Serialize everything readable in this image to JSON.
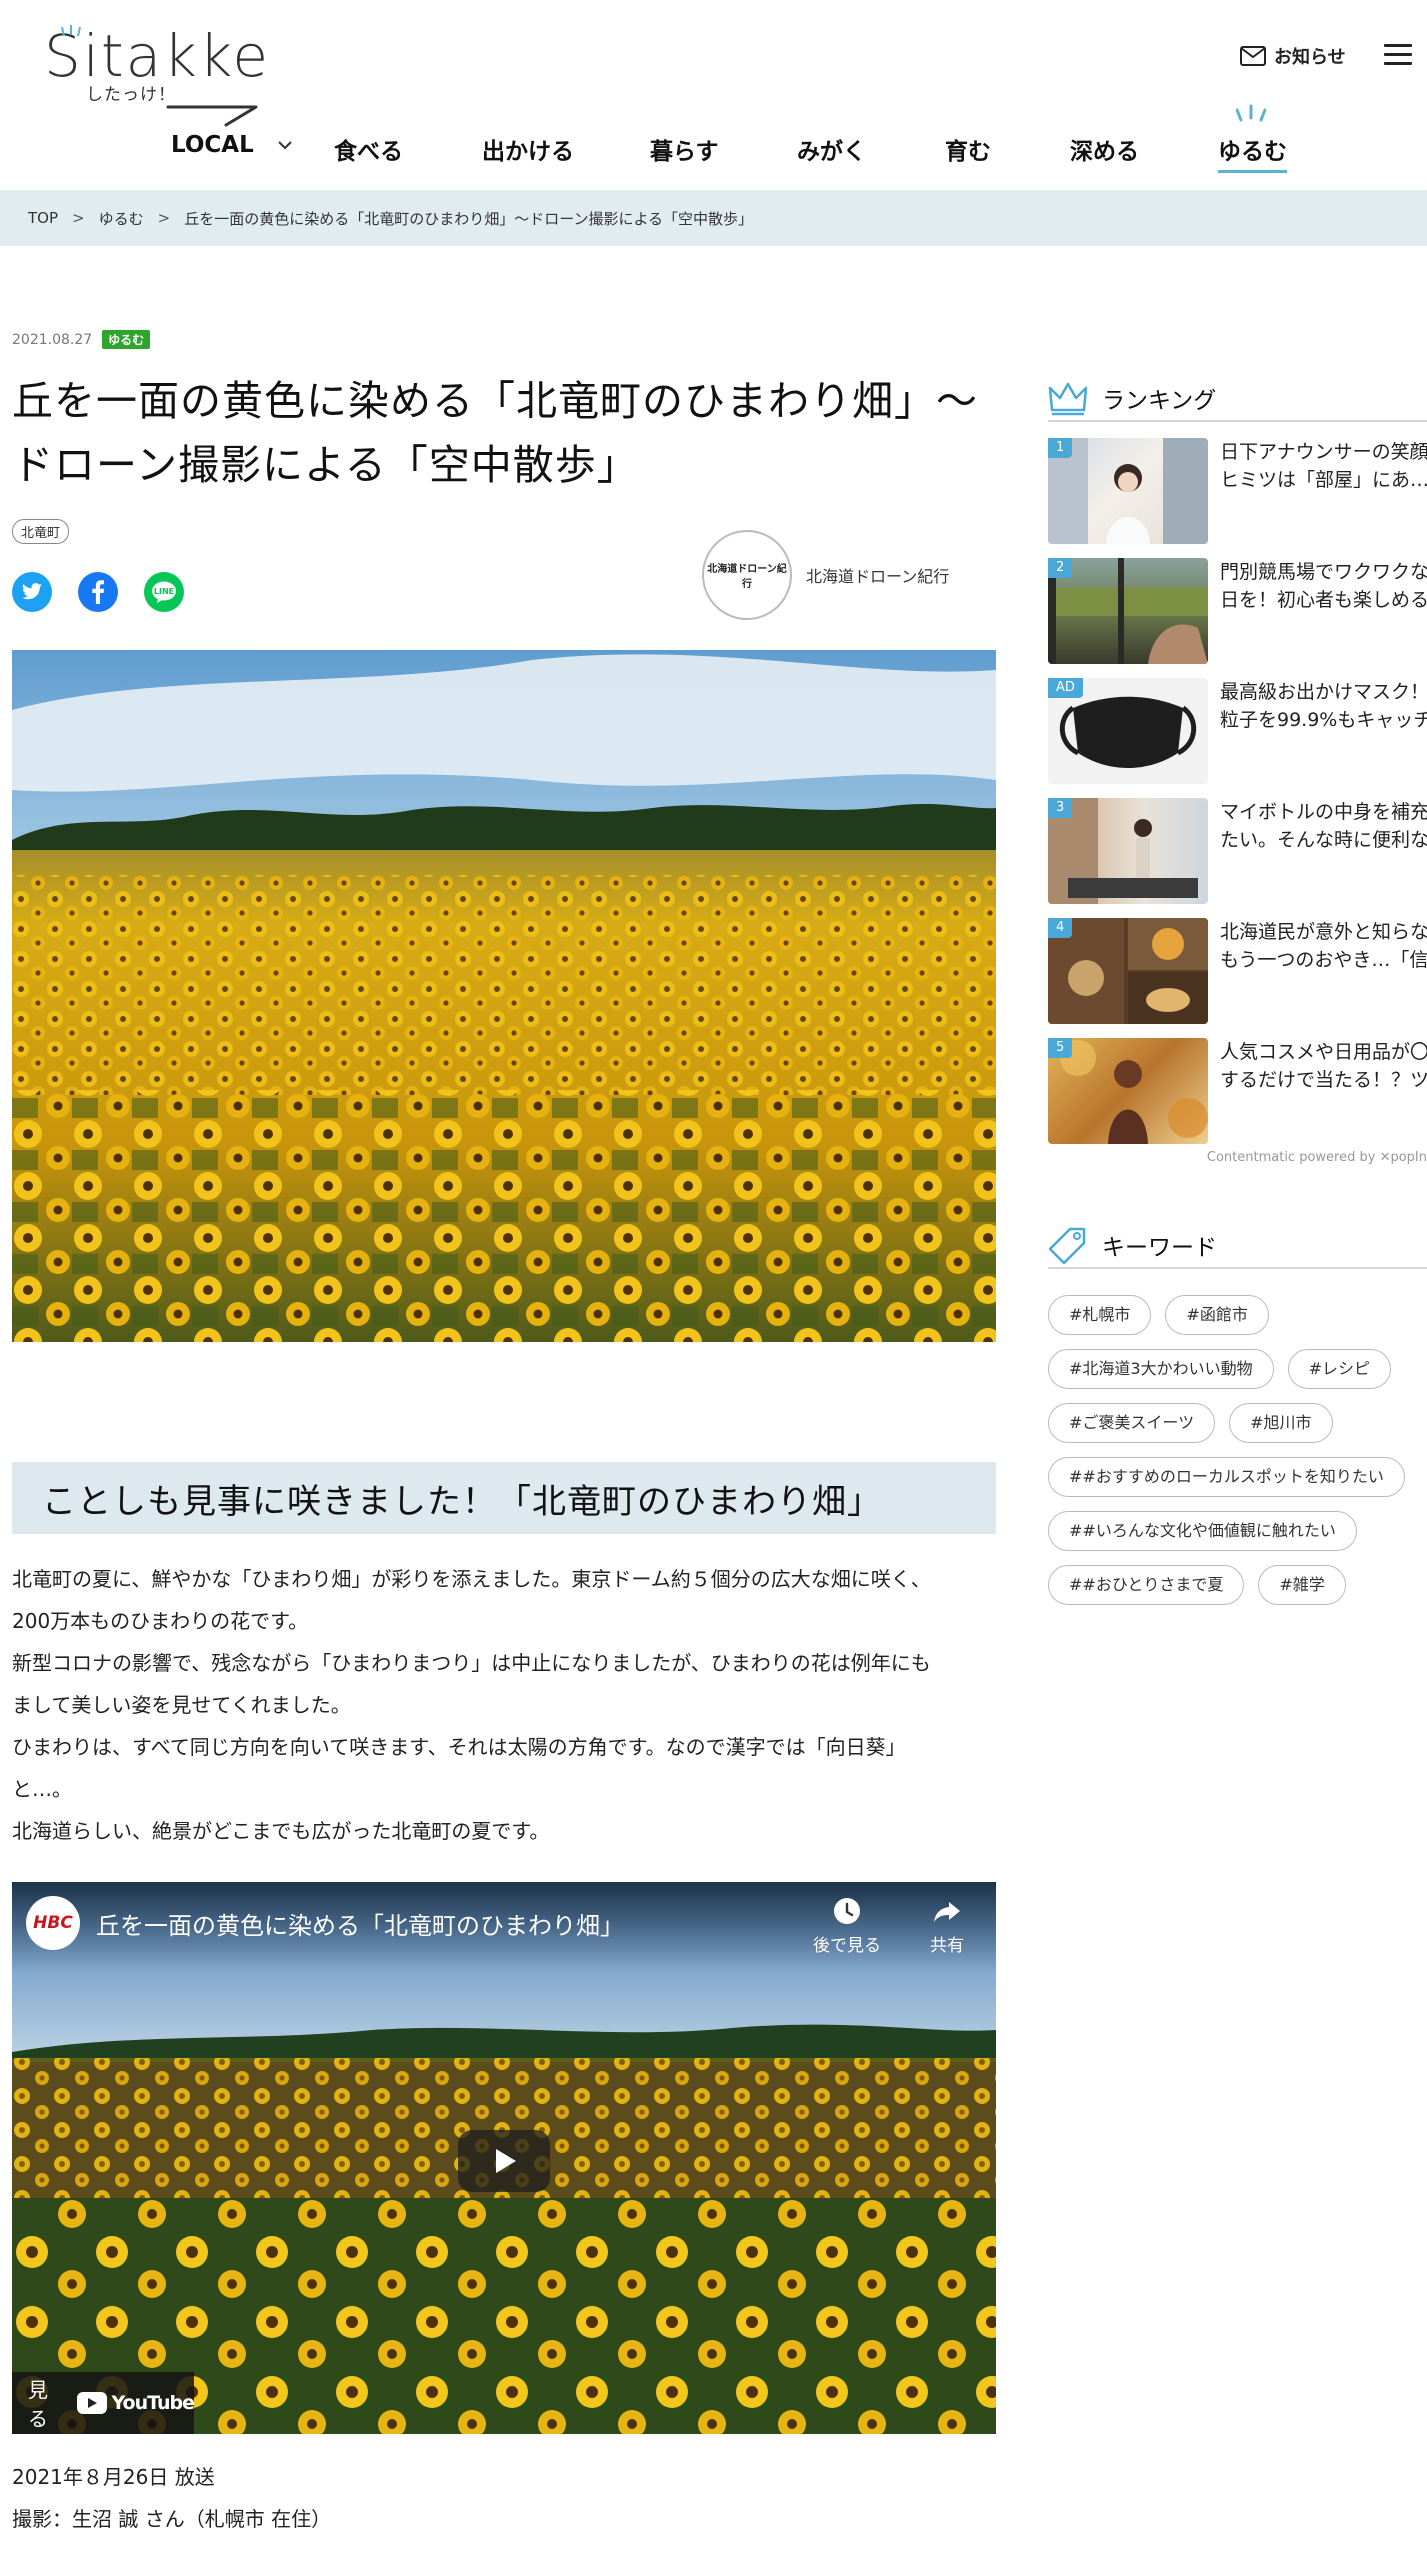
{
  "header": {
    "logo_text": "Sitakke",
    "logo_sub": "したっけ！",
    "notice_label": "お知らせ"
  },
  "nav": {
    "items": [
      {
        "label": "LOCAL"
      },
      {
        "label": "食べる"
      },
      {
        "label": "出かける"
      },
      {
        "label": "暮らす"
      },
      {
        "label": "みがく"
      },
      {
        "label": "育む"
      },
      {
        "label": "深める"
      },
      {
        "label": "ゆるむ",
        "active": true
      }
    ]
  },
  "breadcrumb": {
    "items": [
      "TOP",
      "ゆるむ",
      "丘を一面の黄色に染める「北竜町のひまわり畑」〜ドローン撮影による「空中散歩」"
    ],
    "separator": ">"
  },
  "article": {
    "date": "2021.08.27",
    "category": "ゆるむ",
    "title_line1": "丘を一面の黄色に染める「北竜町のひまわり畑」〜",
    "title_line2": "ドローン撮影による「空中散歩」",
    "tag": "北竜町",
    "author_logo": "北海道ドローン紀行",
    "author_name": "北海道ドローン紀行",
    "section_heading": "ことしも見事に咲きました！「北竜町のひまわり畑」",
    "paragraphs": [
      "北竜町の夏に、鮮やかな「ひまわり畑」が彩りを添えました。東京ドーム約５個分の広大な畑に咲く、",
      "200万本ものひまわりの花です。",
      "新型コロナの影響で、残念ながら「ひまわりまつり」は中止になりましたが、ひまわりの花は例年にも",
      "まして美しい姿を見せてくれました。",
      "ひまわりは、すべて同じ方向を向いて咲きます、それは太陽の方角です。なので漢字では「向日葵」",
      "と…。",
      "北海道らしい、絶景がどこまでも広がった北竜町の夏です。"
    ],
    "video": {
      "channel_badge": "HBC",
      "title": "丘を一面の黄色に染める「北竜町のひまわり畑」",
      "watch_later": "後で見る",
      "share": "共有",
      "watch_on": "見る",
      "youtube": "YouTube"
    },
    "caption_lines": [
      "2021年８月26日 放送",
      "撮影：生沼 誠 さん（札幌市 在住）"
    ]
  },
  "sidebar": {
    "ranking_title": "ランキング",
    "ranking": [
      {
        "badge": "1",
        "line1": "日下アナウンサーの笑顔",
        "line2": "ヒミツは「部屋」にあ…"
      },
      {
        "badge": "2",
        "line1": "門別競馬場でワクワクな",
        "line2": "日を！初心者も楽しめる"
      },
      {
        "badge": "AD",
        "line1": "最高級お出かけマスク！",
        "line2": "粒子を99.9%もキャッチ"
      },
      {
        "badge": "3",
        "line1": "マイボトルの中身を補充",
        "line2": "たい。そんな時に便利な"
      },
      {
        "badge": "4",
        "line1": "北海道民が意外と知らな",
        "line2": "もう一つのおやき…「信…"
      },
      {
        "badge": "5",
        "line1": "人気コスメや日用品が〇",
        "line2": "するだけで当たる！？ツ…"
      }
    ],
    "powered_by": "Contentmatic powered by ✕popIn",
    "keyword_title": "キーワード",
    "keywords": [
      "#札幌市",
      "#函館市",
      "#北海道3大かわいい動物",
      "#レシピ",
      "#ご褒美スイーツ",
      "#旭川市",
      "##おすすめのローカルスポットを知りたい",
      "##いろんな文化や価値観に触れたい",
      "##おひとりさまで夏",
      "#雑学"
    ]
  },
  "colors": {
    "accent": "#5ab3d6",
    "category_green": "#2ea52c",
    "breadcrumb_bg": "#e1ecf0",
    "section_bg": "#dde9ee",
    "rank_badge": "#4aa8d9",
    "twitter": "#1da1f2",
    "facebook": "#1877f2",
    "line": "#06c755"
  }
}
